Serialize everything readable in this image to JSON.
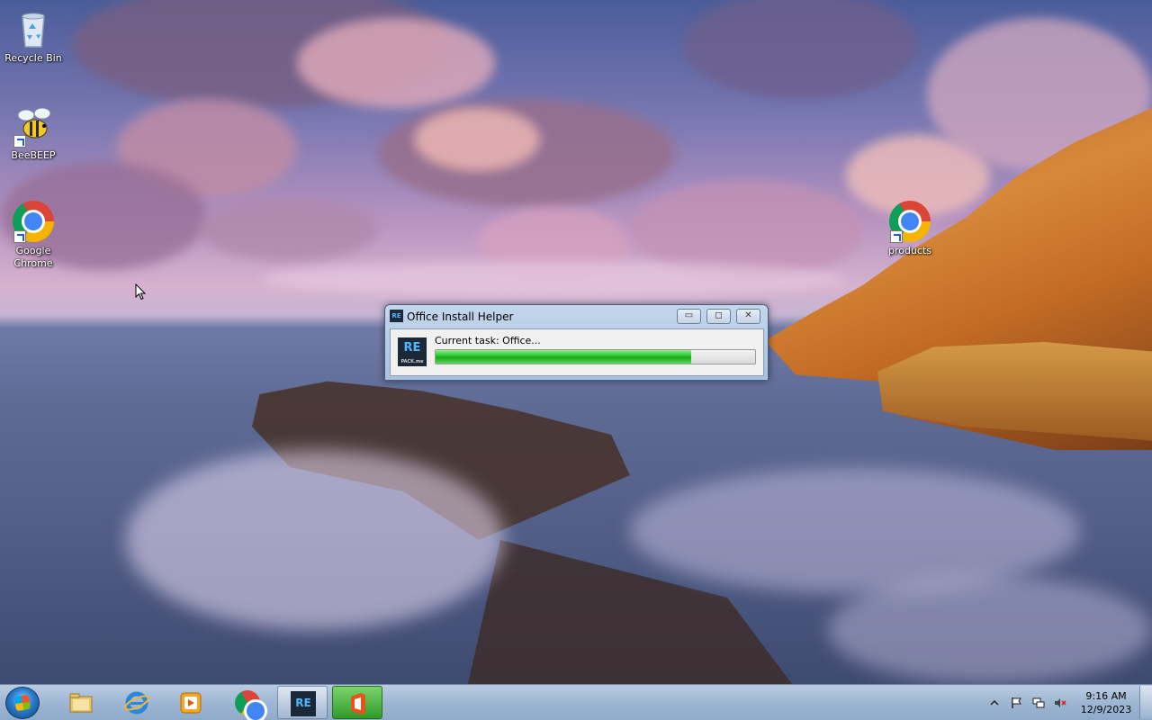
{
  "desktop": {
    "icons": [
      {
        "label": "Recycle Bin"
      },
      {
        "label": "BeeBEEP"
      },
      {
        "label": "Google Chrome"
      },
      {
        "label": "products"
      }
    ]
  },
  "dialog": {
    "title": "Office Install Helper",
    "app_icon_text": "RE",
    "logo_text": "RE",
    "logo_subtext": "PACK.me",
    "task_label": "Current task: Office...",
    "progress_percent": 80,
    "minimize_glyph": "▭",
    "maximize_glyph": "◻",
    "close_glyph": "✕"
  },
  "taskbar": {
    "pinned": [
      {
        "name": "file-explorer-icon"
      },
      {
        "name": "internet-explorer-icon"
      },
      {
        "name": "media-player-icon"
      },
      {
        "name": "chrome-icon"
      },
      {
        "name": "repack-icon"
      },
      {
        "name": "office-icon"
      }
    ],
    "logo_text": "RE",
    "time": "9:16 AM",
    "date": "12/9/2023"
  },
  "colors": {
    "progress_green": "#17a817",
    "taskbar_bg": "#9fb7d3",
    "office_orange": "#e8531c"
  }
}
